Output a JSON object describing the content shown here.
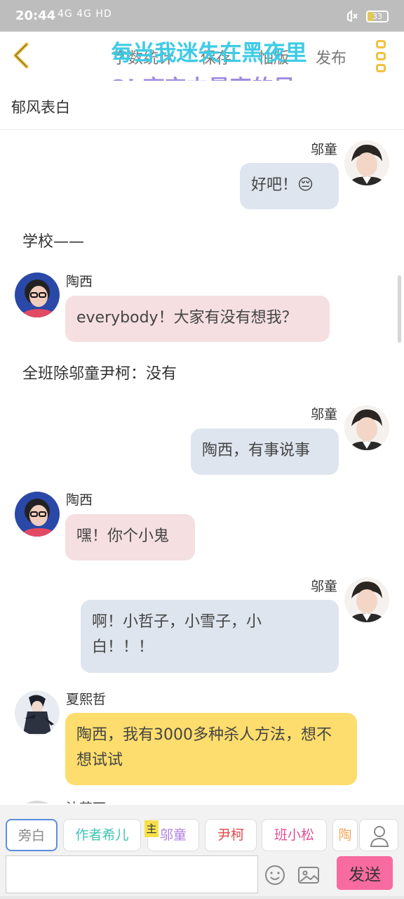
{
  "status": {
    "time": "20:44",
    "signal_text": "4G 4G HD",
    "battery": "33",
    "battery_level": 0.33
  },
  "nav": {
    "items": [
      "字数统计",
      "保存",
      "怕版",
      "发布"
    ]
  },
  "lyrics": {
    "line1": "每当我迷失在黑夜里",
    "line2": "Oh夜空中最亮的星"
  },
  "story": {
    "title": "郁风表白"
  },
  "messages": {
    "m1": {
      "name": "邬童",
      "text": "好吧！😔"
    },
    "n1": "学校——",
    "m2": {
      "name": "陶西",
      "text": "everybody！大家有没有想我？"
    },
    "n2": "全班除邬童尹柯：没有",
    "m3": {
      "name": "邬童",
      "text": "陶西，有事说事"
    },
    "m4": {
      "name": "陶西",
      "text": "嘿！你个小鬼"
    },
    "m5": {
      "name": "邬童",
      "text": "啊！小哲子，小雪子，小白！！！"
    },
    "m6": {
      "name": "夏熙哲",
      "text": "陶西，我有3000多种杀人方法，想不想试试"
    },
    "m7": {
      "name": "沈芸西"
    }
  },
  "roles": {
    "chips": [
      "旁白",
      "作者希儿",
      "邬童",
      "尹柯",
      "班小松",
      "陶"
    ],
    "host_mark": "主",
    "colors": [
      "#888888",
      "#3cc4b4",
      "#b07fe0",
      "#e24a4a",
      "#e0509a",
      "#f5a860"
    ]
  },
  "composer": {
    "placeholder": "",
    "send": "发送"
  },
  "colors": {
    "me_bubble": "#dfe5ee",
    "pink_bubble": "#f5dfe1",
    "yellow_bubble": "#fddd6d",
    "send": "#f86ba0"
  }
}
